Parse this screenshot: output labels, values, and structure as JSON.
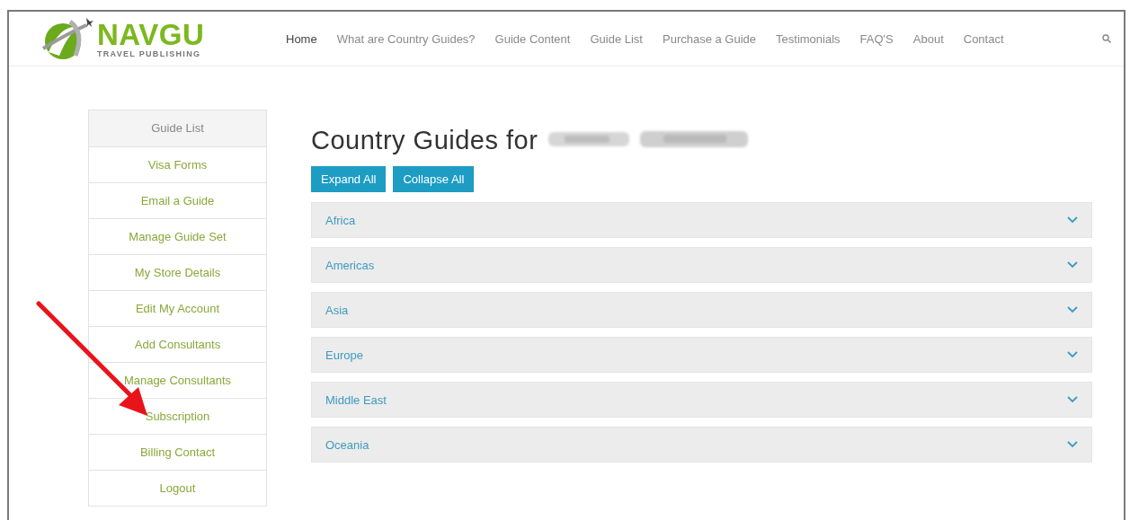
{
  "logo": {
    "name": "NAVGU",
    "tagline": "TRAVEL PUBLISHING"
  },
  "nav": [
    {
      "label": "Home",
      "selected": true
    },
    {
      "label": "What are Country Guides?",
      "selected": false
    },
    {
      "label": "Guide Content",
      "selected": false
    },
    {
      "label": "Guide List",
      "selected": false
    },
    {
      "label": "Purchase a Guide",
      "selected": false
    },
    {
      "label": "Testimonials",
      "selected": false
    },
    {
      "label": "FAQ'S",
      "selected": false
    },
    {
      "label": "About",
      "selected": false
    },
    {
      "label": "Contact",
      "selected": false
    }
  ],
  "sidebar": {
    "items": [
      {
        "label": "Guide List",
        "selected": true
      },
      {
        "label": "Visa Forms",
        "selected": false
      },
      {
        "label": "Email a Guide",
        "selected": false
      },
      {
        "label": "Manage Guide Set",
        "selected": false
      },
      {
        "label": "My Store Details",
        "selected": false
      },
      {
        "label": "Edit My Account",
        "selected": false
      },
      {
        "label": "Add Consultants",
        "selected": false
      },
      {
        "label": "Manage Consultants",
        "selected": false
      },
      {
        "label": "Subscription",
        "selected": false
      },
      {
        "label": "Billing Contact",
        "selected": false
      },
      {
        "label": "Logout",
        "selected": false
      }
    ]
  },
  "heading": "Country Guides for",
  "buttons": [
    "Expand All",
    "Collapse All"
  ],
  "regions": [
    {
      "label": "Africa",
      "expanded": false
    },
    {
      "label": "Americas",
      "expanded": false
    },
    {
      "label": "Asia",
      "expanded": false
    },
    {
      "label": "Europe",
      "expanded": false
    },
    {
      "label": "Middle East",
      "expanded": false
    },
    {
      "label": "Oceania",
      "expanded": false
    }
  ]
}
